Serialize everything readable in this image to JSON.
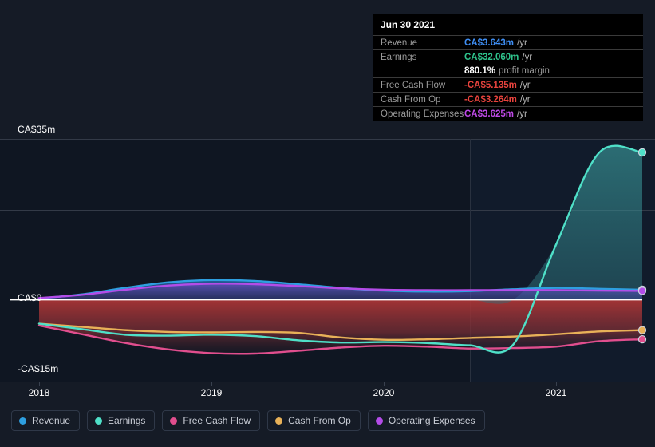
{
  "chart_data": {
    "type": "area",
    "title": "",
    "xlabel": "",
    "ylabel": "",
    "currency": "CA$",
    "units": "m",
    "ylim": [
      -15,
      35
    ],
    "y_ticks": [
      "CA$35m",
      "CA$0",
      "-CA$15m"
    ],
    "y_tick_values": [
      35,
      0,
      -15
    ],
    "x_ticks": [
      "2018",
      "2019",
      "2020",
      "2021"
    ],
    "x_tick_values": [
      2018,
      2019,
      2020,
      2021
    ],
    "grid": true,
    "legend_position": "bottom",
    "forecast_divider_x": 2020.45,
    "x": [
      2018.0,
      2018.25,
      2018.5,
      2018.75,
      2019.0,
      2019.25,
      2019.5,
      2019.75,
      2020.0,
      2020.25,
      2020.5,
      2020.75,
      2021.0,
      2021.25,
      2021.5
    ],
    "series": [
      {
        "name": "Revenue",
        "color": "#2e9fe0",
        "values": [
          0.3,
          1.2,
          2.6,
          3.8,
          4.3,
          4.1,
          3.4,
          2.6,
          2.0,
          1.8,
          1.9,
          2.3,
          2.6,
          2.4,
          2.2
        ]
      },
      {
        "name": "Earnings",
        "color": "#4fe0c8",
        "values": [
          -5.2,
          -6.4,
          -7.6,
          -7.8,
          -7.6,
          -7.9,
          -8.8,
          -9.3,
          -9.2,
          -9.4,
          -9.9,
          -9.8,
          12.0,
          32.0,
          32.06
        ]
      },
      {
        "name": "Free Cash Flow",
        "color": "#e14e8e",
        "values": [
          -5.6,
          -7.5,
          -9.4,
          -10.8,
          -11.6,
          -11.7,
          -11.1,
          -10.4,
          -10.0,
          -10.2,
          -10.6,
          -10.5,
          -10.2,
          -9.0,
          -8.6
        ]
      },
      {
        "name": "Cash From Op",
        "color": "#e8b158",
        "values": [
          -5.2,
          -5.9,
          -6.6,
          -7.0,
          -7.1,
          -7.0,
          -7.2,
          -8.2,
          -8.7,
          -8.6,
          -8.3,
          -8.0,
          -7.5,
          -6.9,
          -6.6
        ]
      },
      {
        "name": "Operating Expenses",
        "color": "#b44ce8",
        "values": [
          0.4,
          1.1,
          2.2,
          3.1,
          3.5,
          3.4,
          3.0,
          2.5,
          2.2,
          2.1,
          2.1,
          2.1,
          2.1,
          2.0,
          1.95
        ]
      }
    ]
  },
  "axis": {
    "y_top": "CA$35m",
    "y_zero": "CA$0",
    "y_bottom": "-CA$15m",
    "x": [
      "2018",
      "2019",
      "2020",
      "2021"
    ]
  },
  "tooltip": {
    "title": "Jun 30 2021",
    "rows": [
      {
        "label": "Revenue",
        "value": "CA$3.643m",
        "unit": "/yr",
        "color": "#3f8ff5"
      },
      {
        "label": "Earnings",
        "value": "CA$32.060m",
        "unit": "/yr",
        "color": "#2fc48d"
      },
      {
        "label": "Free Cash Flow",
        "value": "-CA$5.135m",
        "unit": "/yr",
        "color": "#e8433d"
      },
      {
        "label": "Cash From Op",
        "value": "-CA$3.264m",
        "unit": "/yr",
        "color": "#e8433d"
      },
      {
        "label": "Operating Expenses",
        "value": "CA$3.625m",
        "unit": "/yr",
        "color": "#c04ae8"
      }
    ],
    "profit_margin_value": "880.1%",
    "profit_margin_label": "profit margin"
  },
  "legend": {
    "items": [
      {
        "label": "Revenue",
        "color": "#2e9fe0"
      },
      {
        "label": "Earnings",
        "color": "#4fe0c8"
      },
      {
        "label": "Free Cash Flow",
        "color": "#e14e8e"
      },
      {
        "label": "Cash From Op",
        "color": "#e8b158"
      },
      {
        "label": "Operating Expenses",
        "color": "#b44ce8"
      }
    ]
  }
}
